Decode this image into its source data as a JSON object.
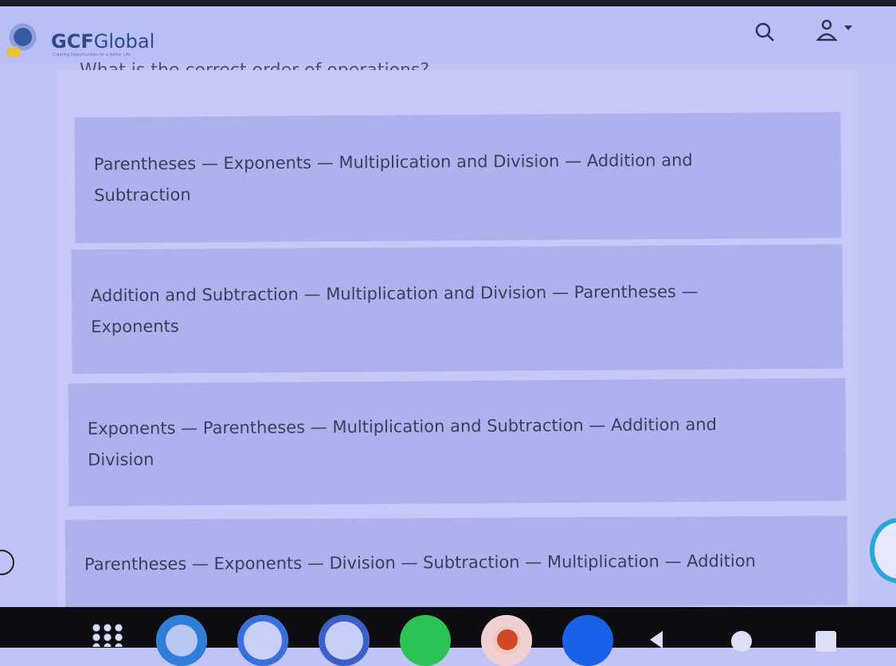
{
  "header": {
    "brand_bold": "GCF",
    "brand_light": "Global",
    "tagline": "Creating Opportunities for a Better Life",
    "search_icon": "search-icon",
    "user_icon": "user-icon"
  },
  "question": "What is the correct order of operations?",
  "options": [
    {
      "line1": "Parentheses — Exponents — Multiplication and Division — Addition and",
      "line2": "Subtraction"
    },
    {
      "line1": "Addition and Subtraction — Multiplication and Division — Parentheses —",
      "line2": "Exponents"
    },
    {
      "line1": "Exponents — Parentheses — Multiplication and Subtraction — Addition and",
      "line2": "Division"
    },
    {
      "line1": "Parentheses — Exponents — Division — Subtraction — Multiplication — Addition",
      "line2": ""
    }
  ],
  "taskbar": {
    "apps": [
      "app-drawer",
      "edge",
      "phone",
      "camera",
      "whatsapp",
      "powerpoint",
      "facebook"
    ],
    "colors": {
      "edge": "#2f7fd8",
      "phone": "#3a6fe0",
      "camera": "#3a5fc8",
      "whatsapp": "#2cc356",
      "powerpoint": "#d24726",
      "facebook": "#1860e8"
    }
  }
}
